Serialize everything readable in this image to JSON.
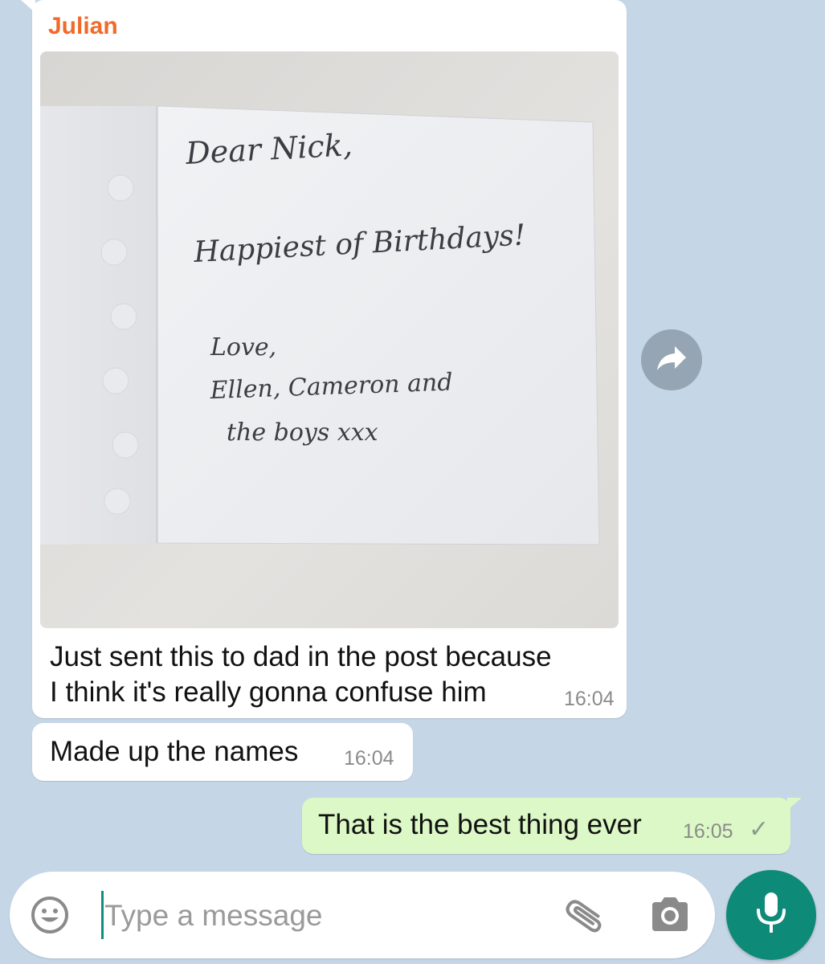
{
  "conversation": {
    "messages": [
      {
        "sender": "Julian",
        "photo": {
          "handwriting": [
            "Dear Nick,",
            "Happiest of Birthdays!",
            "Love,",
            "Ellen, Cameron and",
            "the boys xxx"
          ]
        },
        "text_lines": [
          "Just sent this to dad in the post because",
          "I think it's really gonna confuse him"
        ],
        "time": "16:04"
      },
      {
        "text": "Made up the names",
        "time": "16:04"
      },
      {
        "text": "That is the best thing ever",
        "time": "16:05",
        "status": "sent",
        "status_glyph": "✓"
      }
    ]
  },
  "composer": {
    "placeholder": "Type a message",
    "icons": [
      "emoji-icon",
      "attachment-icon",
      "camera-icon",
      "microphone-icon"
    ]
  },
  "actions": {
    "forward_icon": "forward-icon"
  },
  "colors": {
    "background": "#c5d6e6",
    "sender_name": "#f06a2a",
    "outgoing_bubble": "#dcf8c6",
    "mic_button": "#0e8a78"
  }
}
